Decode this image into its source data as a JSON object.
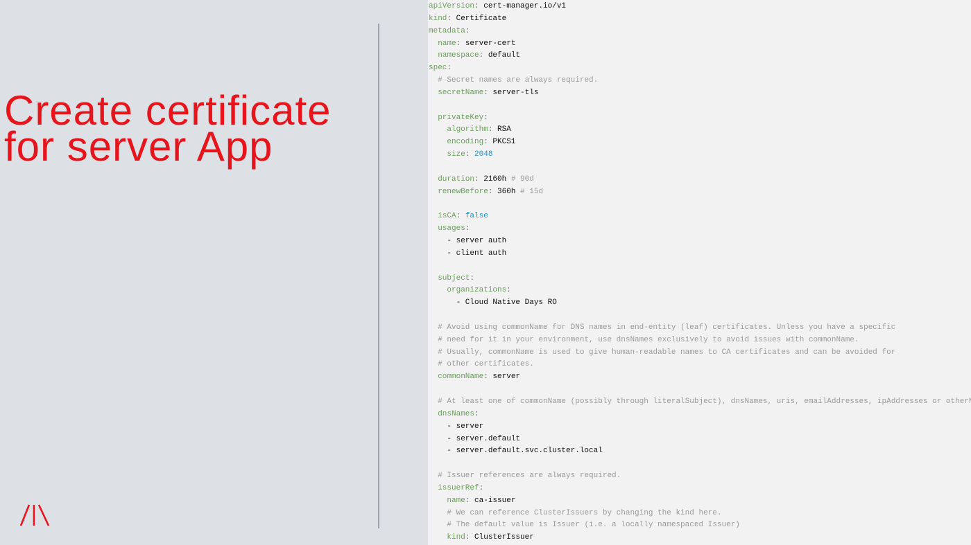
{
  "slide": {
    "title_lines": [
      "Create certificate",
      "for server App"
    ],
    "logo_icon": "logo-slashes-icon",
    "colors": {
      "title": "#e8141b",
      "background": "#dde0e5",
      "code_background": "#f2f2f2",
      "yaml_key": "#6a9e5c",
      "yaml_number": "#1f8fc2",
      "comment": "#9a9a9a"
    }
  },
  "code": {
    "language": "yaml",
    "lines": [
      [
        {
          "t": "k",
          "s": "apiVersion"
        },
        {
          "t": "p",
          "s": ": "
        },
        {
          "t": "v",
          "s": "cert-manager.io/v1"
        }
      ],
      [
        {
          "t": "k",
          "s": "kind"
        },
        {
          "t": "p",
          "s": ": "
        },
        {
          "t": "v",
          "s": "Certificate"
        }
      ],
      [
        {
          "t": "k",
          "s": "metadata"
        },
        {
          "t": "p",
          "s": ":"
        }
      ],
      [
        {
          "t": "v",
          "s": "  "
        },
        {
          "t": "k",
          "s": "name"
        },
        {
          "t": "p",
          "s": ": "
        },
        {
          "t": "v",
          "s": "server-cert"
        }
      ],
      [
        {
          "t": "v",
          "s": "  "
        },
        {
          "t": "k",
          "s": "namespace"
        },
        {
          "t": "p",
          "s": ": "
        },
        {
          "t": "v",
          "s": "default"
        }
      ],
      [
        {
          "t": "k",
          "s": "spec"
        },
        {
          "t": "p",
          "s": ":"
        }
      ],
      [
        {
          "t": "v",
          "s": "  "
        },
        {
          "t": "c",
          "s": "# Secret names are always required."
        }
      ],
      [
        {
          "t": "v",
          "s": "  "
        },
        {
          "t": "k",
          "s": "secretName"
        },
        {
          "t": "p",
          "s": ": "
        },
        {
          "t": "v",
          "s": "server-tls"
        }
      ],
      [],
      [
        {
          "t": "v",
          "s": "  "
        },
        {
          "t": "k",
          "s": "privateKey"
        },
        {
          "t": "p",
          "s": ":"
        }
      ],
      [
        {
          "t": "v",
          "s": "    "
        },
        {
          "t": "k",
          "s": "algorithm"
        },
        {
          "t": "p",
          "s": ": "
        },
        {
          "t": "v",
          "s": "RSA"
        }
      ],
      [
        {
          "t": "v",
          "s": "    "
        },
        {
          "t": "k",
          "s": "encoding"
        },
        {
          "t": "p",
          "s": ": "
        },
        {
          "t": "v",
          "s": "PKCS1"
        }
      ],
      [
        {
          "t": "v",
          "s": "    "
        },
        {
          "t": "k",
          "s": "size"
        },
        {
          "t": "p",
          "s": ": "
        },
        {
          "t": "n",
          "s": "2048"
        }
      ],
      [],
      [
        {
          "t": "v",
          "s": "  "
        },
        {
          "t": "k",
          "s": "duration"
        },
        {
          "t": "p",
          "s": ": "
        },
        {
          "t": "v",
          "s": "2160h "
        },
        {
          "t": "c",
          "s": "# 90d"
        }
      ],
      [
        {
          "t": "v",
          "s": "  "
        },
        {
          "t": "k",
          "s": "renewBefore"
        },
        {
          "t": "p",
          "s": ": "
        },
        {
          "t": "v",
          "s": "360h "
        },
        {
          "t": "c",
          "s": "# 15d"
        }
      ],
      [],
      [
        {
          "t": "v",
          "s": "  "
        },
        {
          "t": "k",
          "s": "isCA"
        },
        {
          "t": "p",
          "s": ": "
        },
        {
          "t": "n",
          "s": "false"
        }
      ],
      [
        {
          "t": "v",
          "s": "  "
        },
        {
          "t": "k",
          "s": "usages"
        },
        {
          "t": "p",
          "s": ":"
        }
      ],
      [
        {
          "t": "v",
          "s": "    - server auth"
        }
      ],
      [
        {
          "t": "v",
          "s": "    - client auth"
        }
      ],
      [],
      [
        {
          "t": "v",
          "s": "  "
        },
        {
          "t": "k",
          "s": "subject"
        },
        {
          "t": "p",
          "s": ":"
        }
      ],
      [
        {
          "t": "v",
          "s": "    "
        },
        {
          "t": "k",
          "s": "organizations"
        },
        {
          "t": "p",
          "s": ":"
        }
      ],
      [
        {
          "t": "v",
          "s": "      - Cloud Native Days RO"
        }
      ],
      [],
      [
        {
          "t": "v",
          "s": "  "
        },
        {
          "t": "c",
          "s": "# Avoid using commonName for DNS names in end-entity (leaf) certificates. Unless you have a specific"
        }
      ],
      [
        {
          "t": "v",
          "s": "  "
        },
        {
          "t": "c",
          "s": "# need for it in your environment, use dnsNames exclusively to avoid issues with commonName."
        }
      ],
      [
        {
          "t": "v",
          "s": "  "
        },
        {
          "t": "c",
          "s": "# Usually, commonName is used to give human-readable names to CA certificates and can be avoided for"
        }
      ],
      [
        {
          "t": "v",
          "s": "  "
        },
        {
          "t": "c",
          "s": "# other certificates."
        }
      ],
      [
        {
          "t": "v",
          "s": "  "
        },
        {
          "t": "k",
          "s": "commonName"
        },
        {
          "t": "p",
          "s": ": "
        },
        {
          "t": "v",
          "s": "server"
        }
      ],
      [],
      [
        {
          "t": "v",
          "s": "  "
        },
        {
          "t": "c",
          "s": "# At least one of commonName (possibly through literalSubject), dnsNames, uris, emailAddresses, ipAddresses or otherNa"
        }
      ],
      [
        {
          "t": "v",
          "s": "  "
        },
        {
          "t": "k",
          "s": "dnsNames"
        },
        {
          "t": "p",
          "s": ":"
        }
      ],
      [
        {
          "t": "v",
          "s": "    - server"
        }
      ],
      [
        {
          "t": "v",
          "s": "    - server.default"
        }
      ],
      [
        {
          "t": "v",
          "s": "    - server.default.svc.cluster.local"
        }
      ],
      [],
      [
        {
          "t": "v",
          "s": "  "
        },
        {
          "t": "c",
          "s": "# Issuer references are always required."
        }
      ],
      [
        {
          "t": "v",
          "s": "  "
        },
        {
          "t": "k",
          "s": "issuerRef"
        },
        {
          "t": "p",
          "s": ":"
        }
      ],
      [
        {
          "t": "v",
          "s": "    "
        },
        {
          "t": "k",
          "s": "name"
        },
        {
          "t": "p",
          "s": ": "
        },
        {
          "t": "v",
          "s": "ca-issuer"
        }
      ],
      [
        {
          "t": "v",
          "s": "    "
        },
        {
          "t": "c",
          "s": "# We can reference ClusterIssuers by changing the kind here."
        }
      ],
      [
        {
          "t": "v",
          "s": "    "
        },
        {
          "t": "c",
          "s": "# The default value is Issuer (i.e. a locally namespaced Issuer)"
        }
      ],
      [
        {
          "t": "v",
          "s": "    "
        },
        {
          "t": "k",
          "s": "kind"
        },
        {
          "t": "p",
          "s": ": "
        },
        {
          "t": "v",
          "s": "ClusterIssuer"
        }
      ]
    ]
  }
}
